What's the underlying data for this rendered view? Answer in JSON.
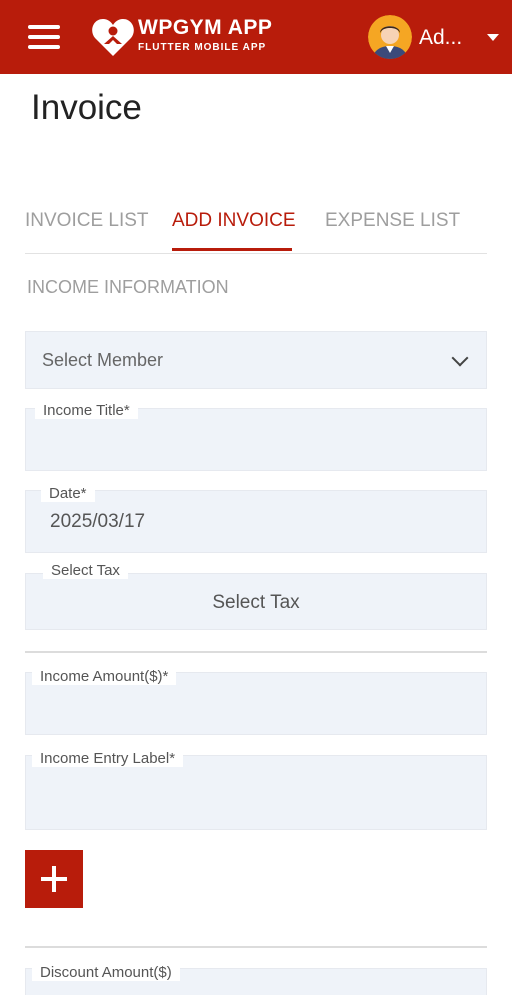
{
  "app": {
    "brand_title": "WPGYM APP",
    "brand_subtitle": "FLUTTER MOBILE APP",
    "user_name": "Ad...",
    "accent_color": "#b81c0b"
  },
  "page": {
    "title": "Invoice"
  },
  "tabs": [
    {
      "label": "INVOICE LIST",
      "active": false
    },
    {
      "label": "ADD INVOICE",
      "active": true
    },
    {
      "label": "EXPENSE LIST",
      "active": false
    }
  ],
  "form": {
    "section_title": "INCOME INFORMATION",
    "member_select": {
      "value": "Select Member"
    },
    "income_title": {
      "label": "Income Title*",
      "value": ""
    },
    "date": {
      "label": "Date*",
      "value": "2025/03/17"
    },
    "tax": {
      "label": "Select Tax",
      "value": "Select Tax"
    },
    "income_amount": {
      "label": "Income Amount($)*",
      "value": ""
    },
    "income_entry_label": {
      "label": "Income Entry Label*",
      "value": ""
    },
    "add_button_icon": "plus-icon",
    "discount_amount": {
      "label": "Discount Amount($)",
      "value": ""
    }
  }
}
